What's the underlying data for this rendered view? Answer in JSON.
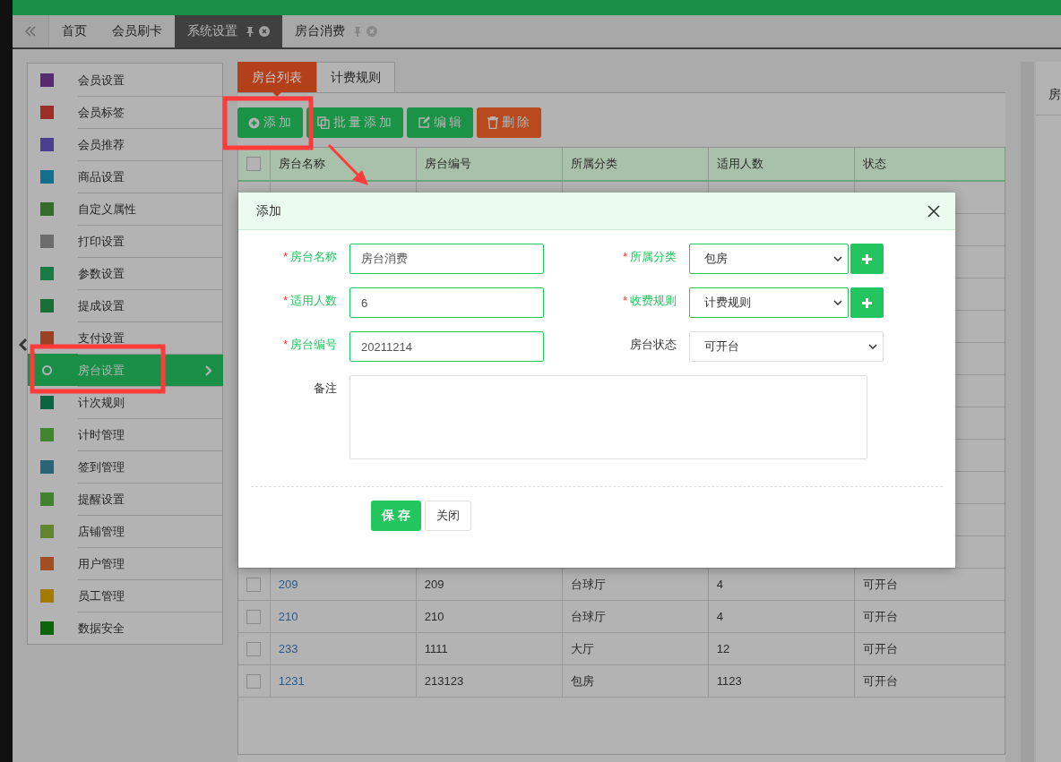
{
  "tabs": [
    {
      "label": "首页",
      "selected": false,
      "pinned": false
    },
    {
      "label": "会员刷卡",
      "selected": false,
      "pinned": false
    },
    {
      "label": "系统设置",
      "selected": true,
      "pinned": true
    },
    {
      "label": "房台消费",
      "selected": false,
      "pinned": true
    }
  ],
  "sidebar": {
    "items": [
      {
        "label": "会员设置",
        "color": "#562c70",
        "selected": false
      },
      {
        "label": "会员标签",
        "color": "#9c2d29",
        "selected": false
      },
      {
        "label": "会员推荐",
        "color": "#4a3f8f",
        "selected": false
      },
      {
        "label": "商品设置",
        "color": "#12708c",
        "selected": false
      },
      {
        "label": "自定义属性",
        "color": "#346c29",
        "selected": false
      },
      {
        "label": "打印设置",
        "color": "#6c6c6c",
        "selected": false
      },
      {
        "label": "参数设置",
        "color": "#187b43",
        "selected": false
      },
      {
        "label": "提成设置",
        "color": "#187038",
        "selected": false
      },
      {
        "label": "支付设置",
        "color": "#9d3f22",
        "selected": false
      },
      {
        "label": "房台设置",
        "color": "#1a8f47",
        "selected": true
      },
      {
        "label": "计次规则",
        "color": "#0b6543",
        "selected": false
      },
      {
        "label": "计时管理",
        "color": "#40862d",
        "selected": false
      },
      {
        "label": "签到管理",
        "color": "#296576",
        "selected": false
      },
      {
        "label": "提醒设置",
        "color": "#40822d",
        "selected": false
      },
      {
        "label": "店铺管理",
        "color": "#62862d",
        "selected": false
      },
      {
        "label": "用户管理",
        "color": "#a24e22",
        "selected": false
      },
      {
        "label": "员工管理",
        "color": "#a27b00",
        "selected": false
      },
      {
        "label": "数据安全",
        "color": "#0b650b",
        "selected": false
      }
    ]
  },
  "content_tabs": [
    {
      "label": "房台列表",
      "selected": true
    },
    {
      "label": "计费规则",
      "selected": false
    }
  ],
  "toolbar": [
    {
      "label": "添加",
      "kind": "primary"
    },
    {
      "label": "批量添加",
      "kind": "primary"
    },
    {
      "label": "编辑",
      "kind": "primary"
    },
    {
      "label": "删除",
      "kind": "danger"
    }
  ],
  "table": {
    "select_all_checked": false,
    "columns": [
      "房台名称",
      "房台编号",
      "所属分类",
      "适用人数",
      "状态"
    ],
    "rows": [
      {
        "checked": false,
        "cells": [
          "209",
          "209",
          "台球厅",
          "4",
          "可开台"
        ]
      },
      {
        "checked": false,
        "cells": [
          "210",
          "210",
          "台球厅",
          "4",
          "可开台"
        ]
      },
      {
        "checked": false,
        "cells": [
          "233",
          "1111",
          "大厅",
          "12",
          "可开台"
        ]
      },
      {
        "checked": false,
        "cells": [
          "1231",
          "213123",
          "包房",
          "1123",
          "可开台"
        ]
      }
    ]
  },
  "right_panel": {
    "title": "房"
  },
  "modal": {
    "title": "添加",
    "fields": [
      {
        "mark": "*",
        "label": "房台名称",
        "kind": "input",
        "value": "房台消费",
        "add_button": false
      },
      {
        "mark": "*",
        "label": "所属分类",
        "kind": "select",
        "value": "包房",
        "add_button": true
      },
      {
        "mark": "*",
        "label": "适用人数",
        "kind": "input",
        "value": "6",
        "add_button": false
      },
      {
        "mark": "*",
        "label": "收费规则",
        "kind": "select",
        "value": "计费规则",
        "add_button": true
      },
      {
        "mark": "*",
        "label": "房台编号",
        "kind": "input",
        "value": "20211214",
        "add_button": false
      },
      {
        "label": "房台状态",
        "kind": "select",
        "value": "可开台",
        "add_button": false
      }
    ],
    "remark_label": "备注",
    "buttons": [
      {
        "label": "保 存",
        "kind": "primary"
      },
      {
        "label": "关闭",
        "kind": "default"
      }
    ]
  }
}
